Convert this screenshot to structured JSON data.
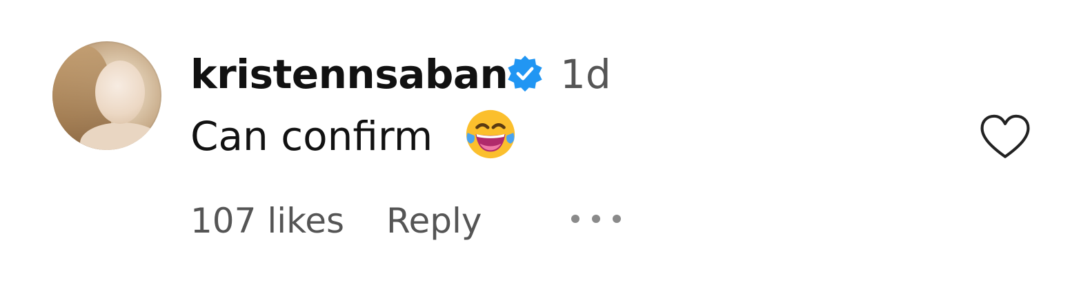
{
  "comment": {
    "username": "kristennsaban",
    "verified": true,
    "timestamp": "1d",
    "text": "Can confirm",
    "emoji": "face-with-tears-of-joy",
    "likes": "107 likes",
    "reply_label": "Reply"
  },
  "colors": {
    "verified_badge": "#2196f3",
    "secondary_text": "#555555",
    "primary_text": "#111111",
    "emoji_yellow": "#fbbf2d"
  },
  "icons": {
    "heart": "heart-outline-icon",
    "more": "more-options-icon",
    "verified": "verified-badge-icon"
  }
}
